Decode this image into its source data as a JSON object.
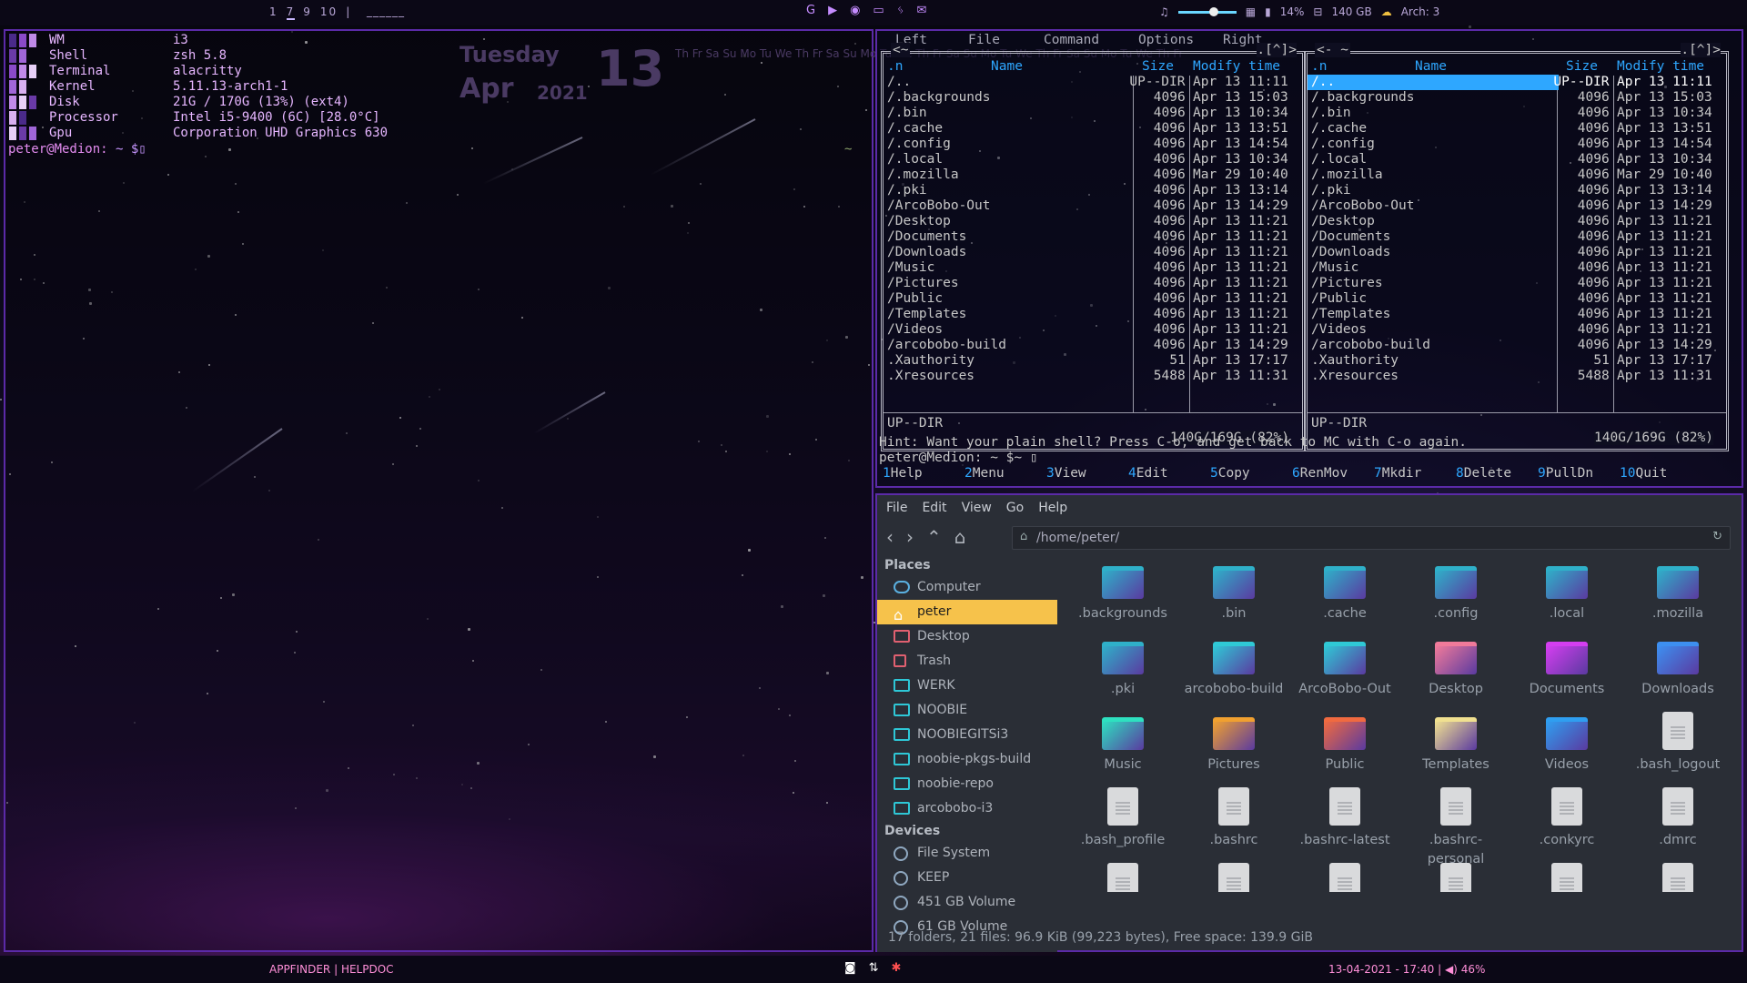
{
  "topbar": {
    "workspaces": [
      "1",
      "7",
      "9",
      "10"
    ],
    "window_title": "______",
    "separator": "|",
    "tray": {
      "volume_icon": "music-note-icon",
      "grid_icon": "apps-grid-icon",
      "memory": "14%",
      "disk": "140 GB",
      "updates": "Arch: 3"
    }
  },
  "neofetch": [
    {
      "key": "WM",
      "value": "i3"
    },
    {
      "key": "Shell",
      "value": "zsh 5.8"
    },
    {
      "key": "Terminal",
      "value": "alacritty"
    },
    {
      "key": "Kernel",
      "value": "5.11.13-arch1-1"
    },
    {
      "key": "Disk",
      "value": "21G / 170G (13%) (ext4)"
    },
    {
      "key": "Processor",
      "value": "Intel  i5-9400  (6C) [28.0°C]"
    },
    {
      "key": "Gpu",
      "value": "Corporation UHD Graphics 630"
    }
  ],
  "terminal": {
    "prompt_user": "peter@Medion:",
    "prompt_rest": " ~ $",
    "cursor": "▯",
    "tilde": "~"
  },
  "clock": {
    "weekday": "Tuesday",
    "month": "Apr",
    "year": "2021",
    "day": "13"
  },
  "calendar_strip": "Th Fr Sa Su Mo Tu We Th Fr Sa Su Mo Tu We Th Fr Sa Su Mo Tu We Th Fr Sa Su Mo Tu We Th Fr",
  "mc": {
    "menu": [
      "Left",
      "File",
      "Command",
      "Options",
      "Right"
    ],
    "left_path": "<~",
    "right_path": "<- ~",
    "col_n": ".n",
    "col_name": "Name",
    "col_size": "Size",
    "col_mtime": "Modify time",
    "rows": [
      {
        "name": "/..",
        "size": "UP--DIR",
        "date": "Apr 13 11:11"
      },
      {
        "name": "/.backgrounds",
        "size": "4096",
        "date": "Apr 13 15:03"
      },
      {
        "name": "/.bin",
        "size": "4096",
        "date": "Apr 13 10:34"
      },
      {
        "name": "/.cache",
        "size": "4096",
        "date": "Apr 13 13:51"
      },
      {
        "name": "/.config",
        "size": "4096",
        "date": "Apr 13 14:54"
      },
      {
        "name": "/.local",
        "size": "4096",
        "date": "Apr 13 10:34"
      },
      {
        "name": "/.mozilla",
        "size": "4096",
        "date": "Mar 29 10:40"
      },
      {
        "name": "/.pki",
        "size": "4096",
        "date": "Apr 13 13:14"
      },
      {
        "name": "/ArcoBobo-Out",
        "size": "4096",
        "date": "Apr 13 14:29"
      },
      {
        "name": "/Desktop",
        "size": "4096",
        "date": "Apr 13 11:21"
      },
      {
        "name": "/Documents",
        "size": "4096",
        "date": "Apr 13 11:21"
      },
      {
        "name": "/Downloads",
        "size": "4096",
        "date": "Apr 13 11:21"
      },
      {
        "name": "/Music",
        "size": "4096",
        "date": "Apr 13 11:21"
      },
      {
        "name": "/Pictures",
        "size": "4096",
        "date": "Apr 13 11:21"
      },
      {
        "name": "/Public",
        "size": "4096",
        "date": "Apr 13 11:21"
      },
      {
        "name": "/Templates",
        "size": "4096",
        "date": "Apr 13 11:21"
      },
      {
        "name": "/Videos",
        "size": "4096",
        "date": "Apr 13 11:21"
      },
      {
        "name": "/arcobobo-build",
        "size": "4096",
        "date": "Apr 13 14:29"
      },
      {
        "name": " .Xauthority",
        "size": "51",
        "date": "Apr 13 17:17"
      },
      {
        "name": " .Xresources",
        "size": "5488",
        "date": "Apr 13 11:31"
      }
    ],
    "status": "UP--DIR",
    "free": "140G/169G (82%)",
    "hint": "Hint: Want your plain shell? Press C-o, and get back to MC with C-o again.",
    "prompt": "peter@Medion: ~ $~ ▯",
    "fkeys": [
      {
        "n": "1",
        "l": "Help"
      },
      {
        "n": "2",
        "l": "Menu"
      },
      {
        "n": "3",
        "l": "View"
      },
      {
        "n": "4",
        "l": "Edit"
      },
      {
        "n": "5",
        "l": "Copy"
      },
      {
        "n": "6",
        "l": "RenMov"
      },
      {
        "n": "7",
        "l": "Mkdir"
      },
      {
        "n": "8",
        "l": "Delete"
      },
      {
        "n": "9",
        "l": "PullDn"
      },
      {
        "n": "10",
        "l": "Quit"
      }
    ]
  },
  "fm": {
    "menu": [
      "File",
      "Edit",
      "View",
      "Go",
      "Help"
    ],
    "path": "/home/peter/",
    "places_label": "Places",
    "devices_label": "Devices",
    "places": [
      "Computer",
      "peter",
      "Desktop",
      "Trash",
      "WERK",
      "NOOBIE",
      "NOOBIEGITSi3",
      "noobie-pkgs-build",
      "noobie-repo",
      "arcobobo-i3"
    ],
    "devices": [
      "File System",
      "KEEP",
      "451 GB Volume",
      "61 GB Volume"
    ],
    "items": [
      {
        "name": ".backgrounds",
        "kind": "folder",
        "color": "#2fb0c9"
      },
      {
        "name": ".bin",
        "kind": "folder",
        "color": "#2fb0c9"
      },
      {
        "name": ".cache",
        "kind": "folder",
        "color": "#2fb0c9"
      },
      {
        "name": ".config",
        "kind": "folder",
        "color": "#2fb0c9"
      },
      {
        "name": ".local",
        "kind": "folder",
        "color": "#2fb0c9"
      },
      {
        "name": ".mozilla",
        "kind": "folder",
        "color": "#2fb0c9"
      },
      {
        "name": ".pki",
        "kind": "folder",
        "color": "#2fb0c9"
      },
      {
        "name": "arcobobo-build",
        "kind": "folder",
        "color": "#2fc9d6"
      },
      {
        "name": "ArcoBobo-Out",
        "kind": "folder",
        "color": "#2fc9d6"
      },
      {
        "name": "Desktop",
        "kind": "folder",
        "color": "#f07a9a"
      },
      {
        "name": "Documents",
        "kind": "folder",
        "color": "#d43ef0"
      },
      {
        "name": "Downloads",
        "kind": "folder",
        "color": "#3d8ff0"
      },
      {
        "name": "Music",
        "kind": "folder",
        "color": "#2ee0c0"
      },
      {
        "name": "Pictures",
        "kind": "folder",
        "color": "#f0a030"
      },
      {
        "name": "Public",
        "kind": "folder",
        "color": "#f06a40"
      },
      {
        "name": "Templates",
        "kind": "folder",
        "color": "#f0e090"
      },
      {
        "name": "Videos",
        "kind": "folder",
        "color": "#2f9ef0"
      },
      {
        "name": ".bash_logout",
        "kind": "file"
      },
      {
        "name": ".bash_profile",
        "kind": "file"
      },
      {
        "name": ".bashrc",
        "kind": "file"
      },
      {
        "name": ".bashrc-latest",
        "kind": "file"
      },
      {
        "name": ".bashrc-personal",
        "kind": "file"
      },
      {
        "name": ".conkyrc",
        "kind": "file"
      },
      {
        "name": ".dmrc",
        "kind": "file"
      },
      {
        "name": "",
        "kind": "file"
      },
      {
        "name": "",
        "kind": "file"
      },
      {
        "name": "",
        "kind": "file"
      },
      {
        "name": "",
        "kind": "file"
      },
      {
        "name": "",
        "kind": "file"
      },
      {
        "name": "",
        "kind": "file"
      }
    ],
    "status": "17 folders, 21 files: 96.9 KiB (99,223 bytes), Free space: 139.9 GiB"
  },
  "botbar": {
    "appfinder": "APPFINDER",
    "helpdoc": "HELPDOC",
    "datetime": "13-04-2021 - 17:40",
    "volume": "46%"
  }
}
